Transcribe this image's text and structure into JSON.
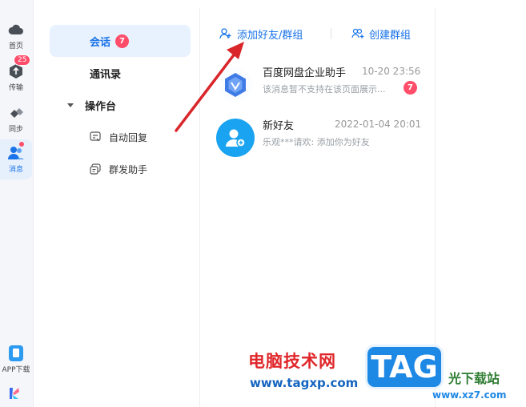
{
  "rail": {
    "items": [
      {
        "label": "首页",
        "icon": "cloud-icon"
      },
      {
        "label": "传输",
        "icon": "transfer-icon",
        "badge": "25"
      },
      {
        "label": "同步",
        "icon": "sync-icon"
      },
      {
        "label": "消息",
        "icon": "message-icon",
        "active": true
      },
      {
        "label": "APP下载",
        "icon": "phone-icon"
      }
    ]
  },
  "menu": {
    "chat": {
      "label": "会话",
      "badge": "7"
    },
    "contacts": {
      "label": "通讯录"
    },
    "console": {
      "label": "操作台"
    },
    "auto_reply": {
      "label": "自动回复"
    },
    "mass_send": {
      "label": "群发助手"
    }
  },
  "actions": {
    "add_friend": "添加好友/群组",
    "create_group": "创建群组"
  },
  "conversations": [
    {
      "name": "百度网盘企业助手",
      "time": "10-20 23:56",
      "preview": "该消息暂不支持在该页面展示...",
      "badge": "7"
    },
    {
      "name": "新好友",
      "time": "2022-01-04 20:01",
      "preview": "乐观***请欢: 添加你为好友"
    }
  ],
  "watermark": {
    "line1": "电脑技术网",
    "line2": "www.tagxp.com",
    "tag": "TAG",
    "line3": "光下载站",
    "line4": "www.xz7.com"
  },
  "colors": {
    "accent": "#1a73e8",
    "badge": "#ff4d6a",
    "annotation_arrow": "#d9262a"
  }
}
